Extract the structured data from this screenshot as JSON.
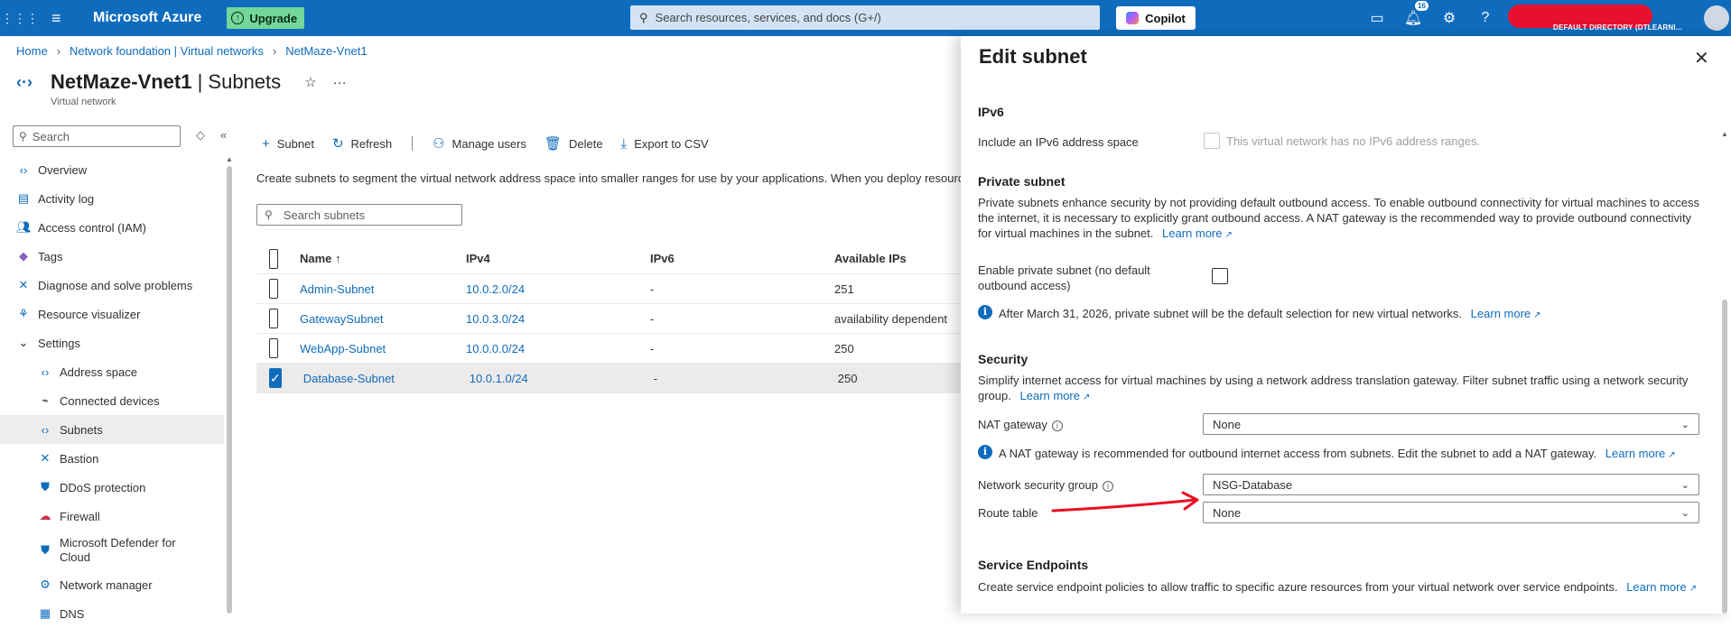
{
  "topbar": {
    "brand": "Microsoft Azure",
    "upgrade_label": "Upgrade",
    "search_placeholder": "Search resources, services, and docs (G+/)",
    "copilot_label": "Copilot",
    "notification_count": "16",
    "directory_label": "DEFAULT DIRECTORY (DTLEARNI...",
    "brand_color": "#0f6cbd"
  },
  "breadcrumb": [
    "Home",
    "Network foundation | Virtual networks",
    "NetMaze-Vnet1"
  ],
  "page": {
    "title_resource": "NetMaze-Vnet1",
    "title_section": " | Subnets",
    "subtitle": "Virtual network"
  },
  "sidebar": {
    "search_placeholder": "Search",
    "items": [
      {
        "label": "Overview",
        "icon": "network-icon"
      },
      {
        "label": "Activity log",
        "icon": "log-icon"
      },
      {
        "label": "Access control (IAM)",
        "icon": "people-icon"
      },
      {
        "label": "Tags",
        "icon": "tag-icon"
      },
      {
        "label": "Diagnose and solve problems",
        "icon": "wrench-icon"
      },
      {
        "label": "Resource visualizer",
        "icon": "visualizer-icon"
      },
      {
        "label": "Settings",
        "icon": "chevron-down-icon"
      },
      {
        "label": "Address space",
        "icon": "network-icon"
      },
      {
        "label": "Connected devices",
        "icon": "plug-icon"
      },
      {
        "label": "Subnets",
        "icon": "network-icon"
      },
      {
        "label": "Bastion",
        "icon": "bastion-icon"
      },
      {
        "label": "DDoS protection",
        "icon": "shield-icon"
      },
      {
        "label": "Firewall",
        "icon": "firewall-icon"
      },
      {
        "label": "Microsoft Defender for Cloud",
        "icon": "defender-icon"
      },
      {
        "label": "Network manager",
        "icon": "network-manager-icon"
      },
      {
        "label": "DNS",
        "icon": "dns-icon"
      }
    ]
  },
  "toolbar": {
    "subnet": "Subnet",
    "refresh": "Refresh",
    "manage_users": "Manage users",
    "delete": "Delete",
    "export": "Export to CSV"
  },
  "intro_text": "Create subnets to segment the virtual network address space into smaller ranges for use by your applications. When you deploy resources",
  "subnet_search_placeholder": "Search subnets",
  "table": {
    "headers": [
      "Name ↑",
      "IPv4",
      "IPv6",
      "Available IPs"
    ],
    "rows": [
      {
        "name": "Admin-Subnet",
        "ipv4": "10.0.2.0/24",
        "ipv6": "-",
        "available": "251",
        "checked": false
      },
      {
        "name": "GatewaySubnet",
        "ipv4": "10.0.3.0/24",
        "ipv6": "-",
        "available": "availability dependent",
        "checked": false
      },
      {
        "name": "WebApp-Subnet",
        "ipv4": "10.0.0.0/24",
        "ipv6": "-",
        "available": "250",
        "checked": false
      },
      {
        "name": "Database-Subnet",
        "ipv4": "10.0.1.0/24",
        "ipv6": "-",
        "available": "250",
        "checked": true
      }
    ]
  },
  "panel": {
    "title": "Edit subnet",
    "ipv6_heading": "IPv6",
    "ipv6_label": "Include an IPv6 address space",
    "ipv6_note": "This virtual network has no IPv6 address ranges.",
    "private_heading": "Private subnet",
    "private_desc_1": "Private subnets enhance security by not providing default outbound access. To enable outbound connectivity for virtual machines to access",
    "private_desc_2": "the internet, it is necessary to explicitly grant outbound access. A NAT gateway is the recommended way to provide outbound connectivity",
    "private_desc_3": "for virtual machines in the subnet.",
    "learn_more": "Learn more",
    "enable_private_1": "Enable private subnet (no default",
    "enable_private_2": "outbound access)",
    "private_info": "After March 31, 2026, private subnet will be the default selection for new virtual networks.",
    "security_heading": "Security",
    "security_desc_1": "Simplify internet access for virtual machines by using a network address translation gateway. Filter subnet traffic using a network security",
    "security_desc_2": "group.",
    "nat_label": "NAT gateway",
    "nat_value": "None",
    "nat_info": "A NAT gateway is recommended for outbound internet access from subnets. Edit the subnet to add a NAT gateway.",
    "nsg_label": "Network security group",
    "nsg_value": "NSG-Database",
    "route_label": "Route table",
    "route_value": "None",
    "endpoints_heading": "Service Endpoints",
    "endpoints_desc": "Create service endpoint policies to allow traffic to specific azure resources from your virtual network over service endpoints.",
    "annotation_color": "#e81123"
  }
}
